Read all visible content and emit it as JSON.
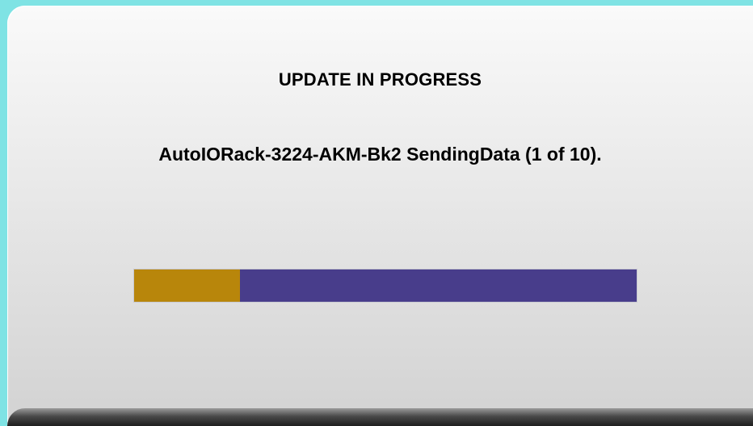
{
  "dialog": {
    "title": "UPDATE IN PROGRESS",
    "status_message": "AutoIORack-3224-AKM-Bk2 SendingData (1 of 10)."
  },
  "progress": {
    "fraction": 0.21,
    "fill_color": "#b8860b",
    "track_color": "#483d8b"
  },
  "colors": {
    "frame_border": "#7fe3e4",
    "text": "#000000"
  }
}
